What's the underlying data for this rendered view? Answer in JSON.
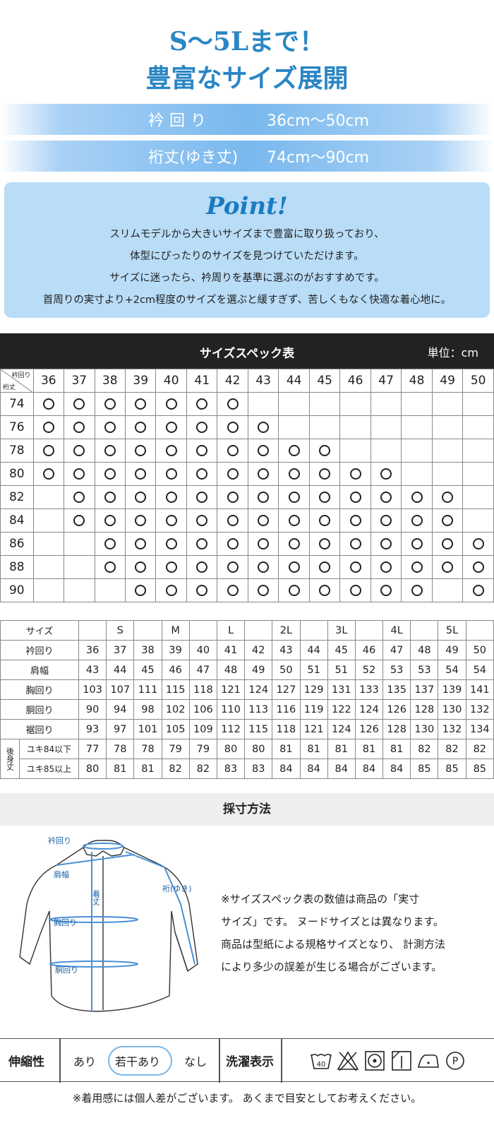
{
  "header": {
    "title_line1": "S～5Lまで！",
    "title_line2": "豊富なサイズ展開"
  },
  "bands": [
    {
      "label": "衿回り",
      "value": "36cm～50cm"
    },
    {
      "label": "裄丈(ゆき丈)",
      "value": "74cm～90cm"
    }
  ],
  "point": {
    "heading": "Point!",
    "lines": [
      "スリムモデルから大きいサイズまで豊富に取り扱っており、",
      "体型にぴったりのサイズを見つけていただけます。",
      "サイズに迷ったら、衿周りを基準に選ぶのがおすすめです。",
      "首周りの実寸より+2cm程度のサイズを選ぶと緩すぎず、苦しくもなく快適な着心地に。"
    ]
  },
  "spec_table": {
    "title": "サイズスペック表",
    "unit": "単位：cm",
    "corner_top": "衿回り",
    "corner_bottom": "裄丈",
    "columns": [
      "36",
      "37",
      "38",
      "39",
      "40",
      "41",
      "42",
      "43",
      "44",
      "45",
      "46",
      "47",
      "48",
      "49",
      "50"
    ],
    "rows": [
      {
        "label": "74",
        "available": [
          1,
          1,
          1,
          1,
          1,
          1,
          1,
          0,
          0,
          0,
          0,
          0,
          0,
          0,
          0
        ]
      },
      {
        "label": "76",
        "available": [
          1,
          1,
          1,
          1,
          1,
          1,
          1,
          1,
          0,
          0,
          0,
          0,
          0,
          0,
          0
        ]
      },
      {
        "label": "78",
        "available": [
          1,
          1,
          1,
          1,
          1,
          1,
          1,
          1,
          1,
          1,
          0,
          0,
          0,
          0,
          0
        ]
      },
      {
        "label": "80",
        "available": [
          1,
          1,
          1,
          1,
          1,
          1,
          1,
          1,
          1,
          1,
          1,
          1,
          0,
          0,
          0
        ]
      },
      {
        "label": "82",
        "available": [
          0,
          1,
          1,
          1,
          1,
          1,
          1,
          1,
          1,
          1,
          1,
          1,
          1,
          1,
          0
        ]
      },
      {
        "label": "84",
        "available": [
          0,
          1,
          1,
          1,
          1,
          1,
          1,
          1,
          1,
          1,
          1,
          1,
          1,
          1,
          0
        ]
      },
      {
        "label": "86",
        "available": [
          0,
          0,
          1,
          1,
          1,
          1,
          1,
          1,
          1,
          1,
          1,
          1,
          1,
          1,
          1
        ]
      },
      {
        "label": "88",
        "available": [
          0,
          0,
          1,
          1,
          1,
          1,
          1,
          1,
          1,
          1,
          1,
          1,
          1,
          1,
          1
        ]
      },
      {
        "label": "90",
        "available": [
          0,
          0,
          0,
          1,
          1,
          1,
          1,
          1,
          1,
          1,
          1,
          1,
          1,
          0,
          1
        ]
      }
    ]
  },
  "size_table": {
    "header_label": "サイズ",
    "size_cells": [
      "",
      "S",
      "",
      "M",
      "",
      "L",
      "",
      "2L",
      "",
      "3L",
      "",
      "4L",
      "",
      "5L",
      ""
    ],
    "rows": [
      {
        "label": "衿回り",
        "values": [
          "36",
          "37",
          "38",
          "39",
          "40",
          "41",
          "42",
          "43",
          "44",
          "45",
          "46",
          "47",
          "48",
          "49",
          "50"
        ]
      },
      {
        "label": "肩幅",
        "values": [
          "43",
          "44",
          "45",
          "46",
          "47",
          "48",
          "49",
          "50",
          "51",
          "51",
          "52",
          "53",
          "53",
          "54",
          "54"
        ]
      },
      {
        "label": "胸回り",
        "values": [
          "103",
          "107",
          "111",
          "115",
          "118",
          "121",
          "124",
          "127",
          "129",
          "131",
          "133",
          "135",
          "137",
          "139",
          "141"
        ]
      },
      {
        "label": "胴回り",
        "values": [
          "90",
          "94",
          "98",
          "102",
          "106",
          "110",
          "113",
          "116",
          "119",
          "122",
          "124",
          "126",
          "128",
          "130",
          "132"
        ]
      },
      {
        "label": "裾回り",
        "values": [
          "93",
          "97",
          "101",
          "105",
          "109",
          "112",
          "115",
          "118",
          "121",
          "124",
          "126",
          "128",
          "130",
          "132",
          "134"
        ]
      }
    ],
    "back_length_side": "後身丈",
    "back_rows": [
      {
        "label": "ユキ84以下",
        "values": [
          "77",
          "78",
          "78",
          "79",
          "79",
          "80",
          "80",
          "81",
          "81",
          "81",
          "81",
          "81",
          "82",
          "82",
          "82"
        ]
      },
      {
        "label": "ユキ85以上",
        "values": [
          "80",
          "81",
          "81",
          "82",
          "82",
          "83",
          "83",
          "84",
          "84",
          "84",
          "84",
          "84",
          "85",
          "85",
          "85"
        ]
      }
    ]
  },
  "measure": {
    "title": "採寸方法",
    "labels": {
      "collar": "衿回り",
      "shoulder": "肩幅",
      "length": "着丈",
      "sleeve": "裄(ゆき)",
      "chest": "胸回り",
      "waist": "胴回り"
    },
    "note_lines": [
      "※サイズスペック表の数値は商品の「実寸",
      "サイズ」です。 ヌードサイズとは異なります。",
      "商品は型紙による規格サイズとなり、 計測方法",
      "により多少の誤差が生じる場合がございます。"
    ],
    "colors": {
      "accent": "#2a86c4",
      "line": "#4a90d9"
    }
  },
  "stretch": {
    "label": "伸縮性",
    "options": [
      "あり",
      "若干あり",
      "なし"
    ],
    "selected": "若干あり"
  },
  "wash": {
    "label": "洗濯表示",
    "icons": [
      "wash-40-icon",
      "no-bleach-icon",
      "tumble-dry-icon",
      "line-dry-shade-icon",
      "iron-low-icon",
      "dry-clean-p-icon"
    ],
    "wash_temp": "40",
    "dry_clean_letter": "P"
  },
  "footer": {
    "note": "※着用感には個人差がございます。 あくまで目安としてお考えください。"
  }
}
